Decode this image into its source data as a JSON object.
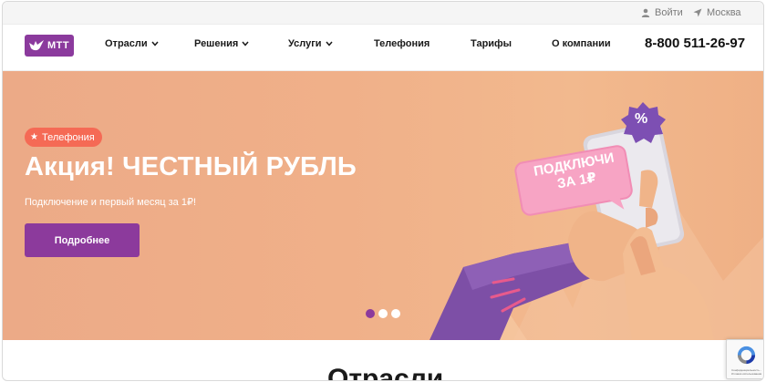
{
  "topbar": {
    "login_label": "Войти",
    "city_label": "Москва"
  },
  "header": {
    "logo_text": "МТТ",
    "nav": [
      {
        "label": "Отрасли",
        "has_dropdown": true
      },
      {
        "label": "Решения",
        "has_dropdown": true
      },
      {
        "label": "Услуги",
        "has_dropdown": true
      },
      {
        "label": "Телефония",
        "has_dropdown": false
      },
      {
        "label": "Тарифы",
        "has_dropdown": false
      },
      {
        "label": "О компании",
        "has_dropdown": false
      }
    ],
    "phone": "8-800 511-26-97"
  },
  "hero": {
    "tag_label": "Телефония",
    "title": "Акция! ЧЕСТНЫЙ РУБЛЬ",
    "subtitle": "Подключение и первый месяц за 1₽!",
    "button_label": "Подробнее",
    "bubble_text_line1": "ПОДКЛЮЧИ",
    "bubble_text_line2": "ЗА 1₽",
    "badge_symbol": "%",
    "slides_total": 3,
    "active_slide": 1
  },
  "section": {
    "title": "Отрасли"
  },
  "recaptcha": {
    "text": "Конфиденциальность - Условия использования"
  },
  "colors": {
    "brand_purple": "#8c3a9c",
    "tag_red": "#f56a55",
    "hero_bg": "#f0b089",
    "bubble_pink": "#f7a4c4"
  }
}
